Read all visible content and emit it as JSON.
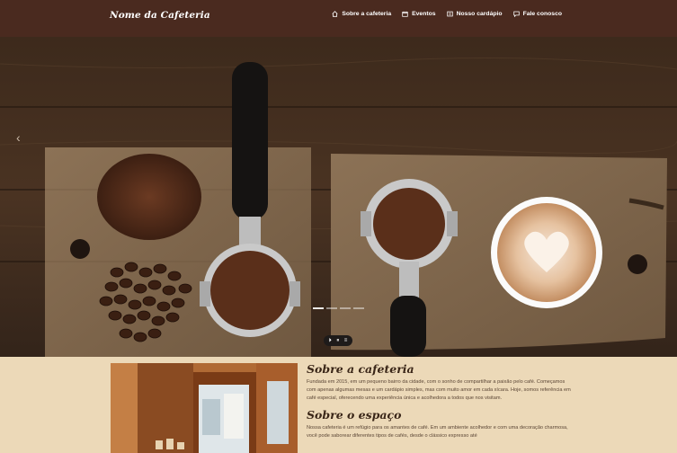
{
  "header": {
    "brand": "Nome da Cafeteria",
    "nav": [
      {
        "label": "Sobre a cafeteria",
        "icon": "home-icon"
      },
      {
        "label": "Eventos",
        "icon": "calendar-icon"
      },
      {
        "label": "Nosso cardápio",
        "icon": "menu-card-icon"
      },
      {
        "label": "Fale conosco",
        "icon": "chat-icon"
      }
    ]
  },
  "hero": {
    "prev_arrow": "‹",
    "media_controls": [
      "⏵",
      "⏸",
      "≡"
    ]
  },
  "about": {
    "title": "Sobre a cafeteria",
    "body": "Fundada em 2015, em um pequeno bairro da cidade, com o sonho de compartilhar a paixão pelo café. Começamos com apenas algumas mesas e um cardápio simples, mas com muito amor em cada xícara. Hoje, somos referência em café especial, oferecendo uma experiência única e acolhedora a todos que nos visitam."
  },
  "space": {
    "title": "Sobre o espaço",
    "body": "Nossa cafeteria é um refúgio para os amantes de café. Em um ambiente acolhedor e com uma decoração charmosa, você pode saborear diferentes tipos de cafés, desde o clássico expresso até"
  },
  "colors": {
    "header_bg": "#4a2a1f",
    "content_bg": "#ecd9b8",
    "title_color": "#3a2618"
  }
}
